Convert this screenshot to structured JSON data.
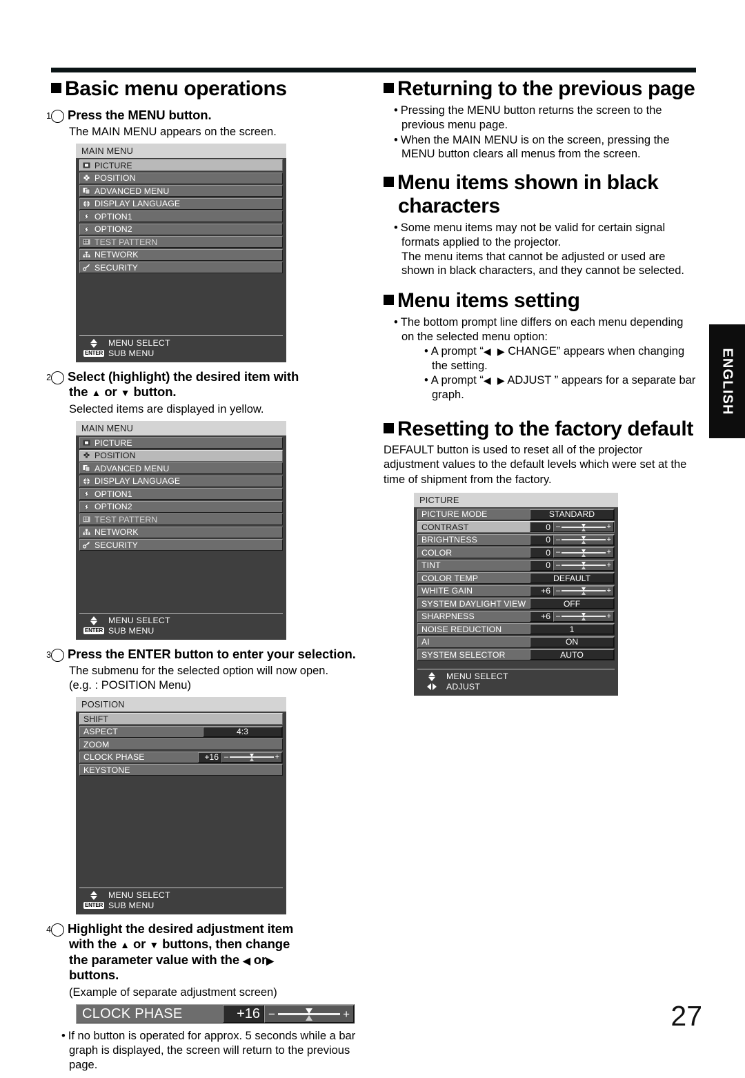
{
  "page": {
    "number": "27",
    "side_tab": "ENGLISH"
  },
  "left_column": {
    "section_title": "Basic menu operations",
    "steps": [
      {
        "num": "1",
        "heading": "Press the MENU button.",
        "body": "The MAIN MENU appears on the screen."
      },
      {
        "num": "2",
        "heading_part1": "Select (highlight) the desired item with",
        "heading_part2_a": "the",
        "heading_part2_b": "or",
        "heading_part2_c": "button.",
        "body": "Selected items are displayed in yellow."
      },
      {
        "num": "3",
        "heading": "Press the ENTER button to enter your selection.",
        "body_line1": "The submenu for the selected option will now open.",
        "body_line2": "(e.g. : POSITION Menu)"
      },
      {
        "num": "4",
        "heading_l1": "Highlight the desired adjustment item",
        "heading_l2_a": "with the",
        "heading_l2_b": "or",
        "heading_l2_c": "buttons, then change",
        "heading_l3_a": "the parameter value with the",
        "heading_l3_b": "or",
        "heading_l4": "buttons.",
        "body": "(Example of separate adjustment screen)",
        "note": "If no button is operated for approx. 5 seconds while a bar graph is displayed, the screen will return to the previous page."
      }
    ]
  },
  "right_column": {
    "sections": [
      {
        "title": "Returning to the previous page",
        "bullets": [
          "Pressing the MENU button returns the screen to the previous menu page.",
          "When the MAIN MENU is on the screen, pressing the MENU button clears all menus from the screen."
        ]
      },
      {
        "title": "Menu items shown in black characters",
        "bullets": [
          "Some menu items may not be valid for certain signal formats applied to the projector.",
          "The menu items that cannot be adjusted or used are shown in black characters, and they cannot be selected."
        ]
      },
      {
        "title": "Menu items setting",
        "lead": "The bottom prompt line differs on each menu depending on the selected menu option:",
        "sub_bullets": [
          {
            "pre": "A prompt “",
            "mid": "CHANGE” appears when changing the setting."
          },
          {
            "pre": "A prompt “",
            "mid": "ADJUST  ” appears for a separate bar graph."
          }
        ]
      },
      {
        "title": "Resetting to the factory default",
        "paragraph": "DEFAULT button is used to reset all of the projector adjustment values to the default levels which were set at the time of shipment from the factory."
      }
    ]
  },
  "osd_main_menu_1": {
    "title": "MAIN MENU",
    "items": [
      {
        "icon": "picture-icon",
        "label": "PICTURE",
        "state": "selected"
      },
      {
        "icon": "position-icon",
        "label": "POSITION",
        "state": "normal"
      },
      {
        "icon": "advanced-icon",
        "label": "ADVANCED MENU",
        "state": "normal"
      },
      {
        "icon": "globe-icon",
        "label": "DISPLAY LANGUAGE",
        "state": "normal"
      },
      {
        "icon": "bolt-icon",
        "label": "OPTION1",
        "state": "normal"
      },
      {
        "icon": "bolt-icon",
        "label": "OPTION2",
        "state": "normal"
      },
      {
        "icon": "pattern-icon",
        "label": "TEST PATTERN",
        "state": "dim"
      },
      {
        "icon": "network-icon",
        "label": "NETWORK",
        "state": "normal"
      },
      {
        "icon": "key-icon",
        "label": "SECURITY",
        "state": "normal"
      }
    ],
    "footer": [
      {
        "key": "updown-arrow",
        "label": "MENU SELECT"
      },
      {
        "key": "ENTER",
        "label": "SUB MENU"
      }
    ]
  },
  "osd_main_menu_2": {
    "title": "MAIN MENU",
    "items": [
      {
        "icon": "picture-icon",
        "label": "PICTURE",
        "state": "normal"
      },
      {
        "icon": "position-icon",
        "label": "POSITION",
        "state": "selected"
      },
      {
        "icon": "advanced-icon",
        "label": "ADVANCED MENU",
        "state": "normal"
      },
      {
        "icon": "globe-icon",
        "label": "DISPLAY LANGUAGE",
        "state": "normal"
      },
      {
        "icon": "bolt-icon",
        "label": "OPTION1",
        "state": "normal"
      },
      {
        "icon": "bolt-icon",
        "label": "OPTION2",
        "state": "normal"
      },
      {
        "icon": "pattern-icon",
        "label": "TEST PATTERN",
        "state": "dim"
      },
      {
        "icon": "network-icon",
        "label": "NETWORK",
        "state": "normal"
      },
      {
        "icon": "key-icon",
        "label": "SECURITY",
        "state": "normal"
      }
    ],
    "footer": [
      {
        "key": "updown-arrow",
        "label": "MENU SELECT"
      },
      {
        "key": "ENTER",
        "label": "SUB MENU"
      }
    ]
  },
  "osd_position_menu": {
    "title": "POSITION",
    "items": [
      {
        "label": "SHIFT",
        "state": "selected",
        "value": null,
        "bar": false
      },
      {
        "label": "ASPECT",
        "state": "normal",
        "value": "4:3",
        "bar": false
      },
      {
        "label": "ZOOM",
        "state": "normal",
        "value": null,
        "bar": false
      },
      {
        "label": "CLOCK PHASE",
        "state": "normal",
        "value": "+16",
        "bar": true
      },
      {
        "label": "KEYSTONE",
        "state": "normal",
        "value": null,
        "bar": false
      }
    ],
    "footer": [
      {
        "key": "updown-arrow",
        "label": "MENU SELECT"
      },
      {
        "key": "ENTER",
        "label": "SUB MENU"
      }
    ]
  },
  "osd_picture_menu": {
    "title": "PICTURE",
    "items": [
      {
        "label": "PICTURE MODE",
        "state": "normal",
        "value": "STANDARD",
        "bar": false
      },
      {
        "label": "CONTRAST",
        "state": "selected",
        "value": "0",
        "bar": true
      },
      {
        "label": "BRIGHTNESS",
        "state": "normal",
        "value": "0",
        "bar": true
      },
      {
        "label": "COLOR",
        "state": "normal",
        "value": "0",
        "bar": true
      },
      {
        "label": "TINT",
        "state": "normal",
        "value": "0",
        "bar": true
      },
      {
        "label": "COLOR TEMP",
        "state": "normal",
        "value": "DEFAULT",
        "bar": false
      },
      {
        "label": "WHITE GAIN",
        "state": "normal",
        "value": "+6",
        "bar": true
      },
      {
        "label": "SYSTEM DAYLIGHT VIEW",
        "state": "normal",
        "value": "OFF",
        "bar": false
      },
      {
        "label": "SHARPNESS",
        "state": "normal",
        "value": "+6",
        "bar": true
      },
      {
        "label": "NOISE REDUCTION",
        "state": "normal",
        "value": "1",
        "bar": false
      },
      {
        "label": "AI",
        "state": "normal",
        "value": "ON",
        "bar": false
      },
      {
        "label": "SYSTEM SELECTOR",
        "state": "normal",
        "value": "AUTO",
        "bar": false
      }
    ],
    "footer": [
      {
        "key": "updown-arrow",
        "label": "MENU SELECT"
      },
      {
        "key": "leftright-arrow",
        "label": "ADJUST"
      }
    ]
  },
  "adjust_bar_example": {
    "label": "CLOCK PHASE",
    "value": "+16",
    "minus": "−",
    "plus": "+"
  },
  "colors": {
    "osd_background": "#3f3f3f",
    "osd_title_bar": "#d4d4d4",
    "osd_row": "#6d6d6d",
    "osd_row_selected": "#b9b9b9",
    "osd_value_field": "#2a2a2a",
    "tab_background": "#0d0d0d",
    "rule": "#0b1416"
  }
}
